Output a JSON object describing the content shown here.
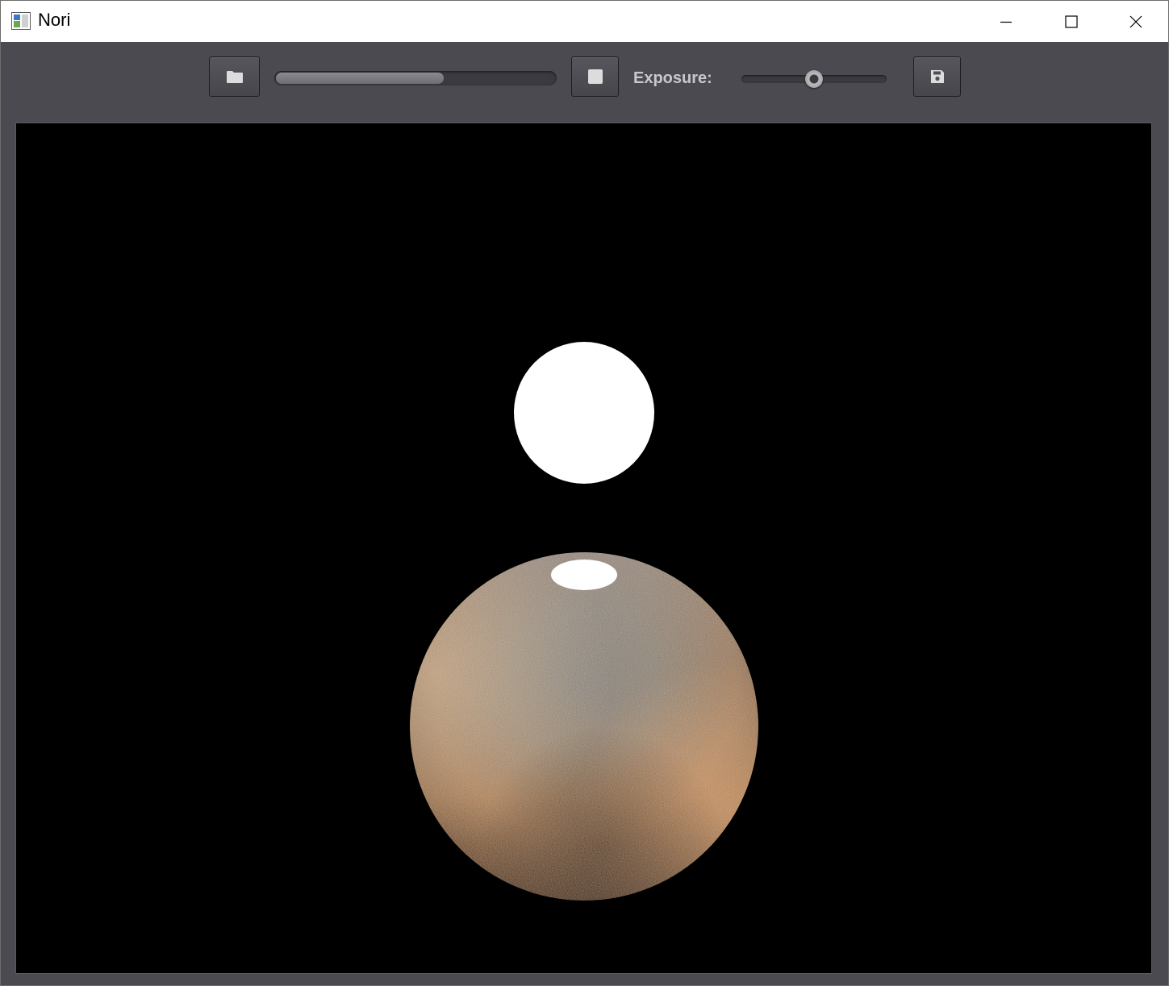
{
  "window": {
    "title": "Nori",
    "controls": {
      "minimize_icon": "minimize-icon",
      "maximize_icon": "maximize-icon",
      "close_icon": "close-icon"
    }
  },
  "toolbar": {
    "open_icon": "folder-icon",
    "stop_icon": "stop-icon",
    "save_icon": "save-icon",
    "progress": 0.6,
    "exposure_label": "Exposure:",
    "exposure_value": 0.5
  },
  "render": {
    "background": "#000000",
    "light_color": "#ffffff",
    "sphere_colors": [
      "#e8a66a",
      "#8a8f94",
      "#3a2418"
    ]
  }
}
